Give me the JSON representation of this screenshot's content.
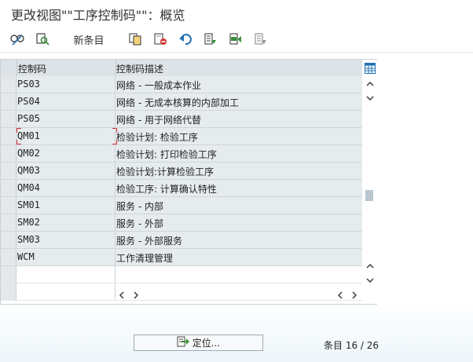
{
  "window": {
    "title": "更改视图\"\"工序控制码\"\"：概览"
  },
  "toolbar": {
    "display_change_icon": "glasses-pencil-icon",
    "display_icon": "magnifier-icon",
    "new_entries_label": "新条目",
    "copy_icon": "copy-icon",
    "delete_icon": "delete-icon",
    "undo_icon": "undo-icon",
    "select_all_icon": "select-all-icon",
    "select_block_icon": "select-block-icon",
    "deselect_all_icon": "deselect-all-icon"
  },
  "table": {
    "headers": {
      "code": "控制码",
      "description": "控制码描述"
    },
    "rows": [
      {
        "code": "PS03",
        "description": "网络 - 一般成本作业"
      },
      {
        "code": "PS04",
        "description": "网络 - 无成本核算的内部加工"
      },
      {
        "code": "PS05",
        "description": "网络 - 用于网络代替"
      },
      {
        "code": "QM01",
        "description": "检验计划: 检验工序"
      },
      {
        "code": "QM02",
        "description": "检验计划: 打印检验工序"
      },
      {
        "code": "QM03",
        "description": "检验计划:计算检验工序"
      },
      {
        "code": "QM04",
        "description": "检验工序: 计算确认特性"
      },
      {
        "code": "SM01",
        "description": "服务 - 内部"
      },
      {
        "code": "SM02",
        "description": "服务 - 外部"
      },
      {
        "code": "SM03",
        "description": "服务 - 外部服务"
      },
      {
        "code": "WCM",
        "description": "工作清理管理"
      }
    ],
    "empty_rows": 2,
    "scroll_position_fraction": 0.6
  },
  "footer": {
    "locate_label": "定位...",
    "entries_label": "条目",
    "entries_value": "16 / 26"
  },
  "colors": {
    "accent_blue": "#1f6fb5",
    "delete_red": "#d0312d",
    "green": "#3a8f3a"
  }
}
